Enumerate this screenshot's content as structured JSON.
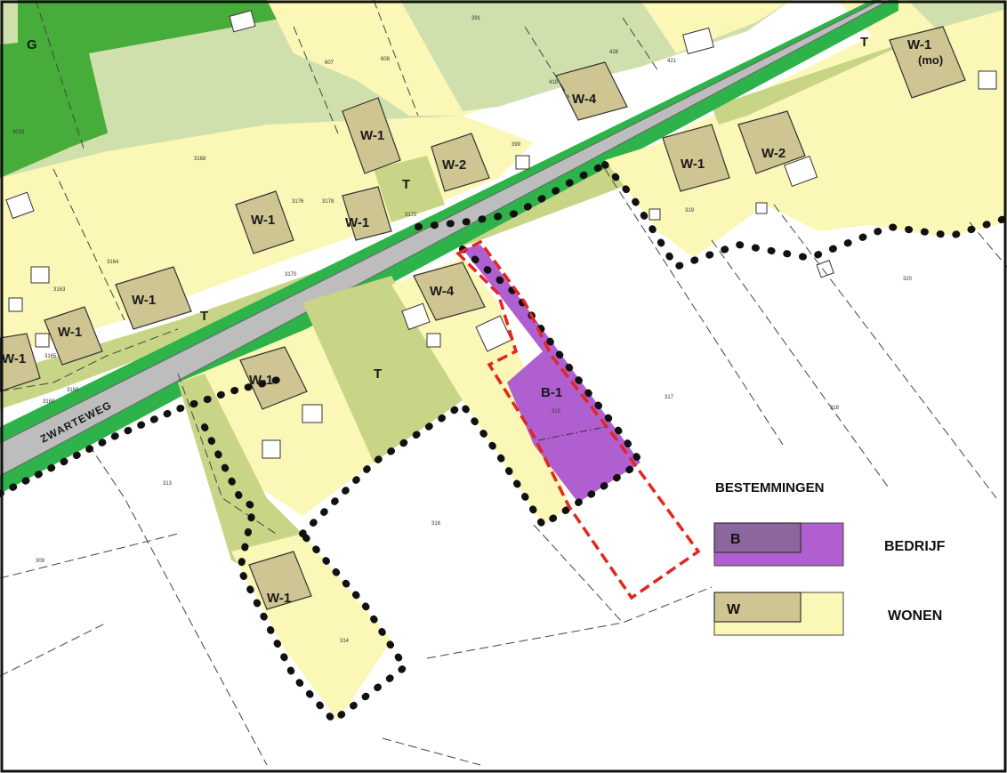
{
  "road": {
    "name": "ZWARTEWEG"
  },
  "labels": {
    "g": "G",
    "t_top": "T",
    "t_mid": "T",
    "t_left": "T",
    "t_south": "T",
    "w1_mo": "W-1",
    "mo": "(mo)",
    "w1_north_a": "W-1",
    "w1_north_b": "W-1",
    "w1_north_c": "W-1",
    "w1_left_a": "W-1",
    "w1_left_b": "W-1",
    "w1_left_c": "W-1",
    "w1_east": "W-1",
    "w1_south": "W-1",
    "w1_south2": "W-1",
    "w2_north": "W-2",
    "w2_east": "W-2",
    "w4_north": "W-4",
    "w4_south": "W-4",
    "b1": "B-1"
  },
  "numbers": {
    "n391": "391",
    "n607": "607",
    "n608": "608",
    "n3033": "3033",
    "n3168": "3168",
    "n3164": "3164",
    "n3163": "3163",
    "n3176": "3176",
    "n3178": "3178",
    "n3172": "3172",
    "n3170": "3170",
    "n421": "421",
    "n419": "419",
    "n428": "428",
    "n399": "399",
    "n317": "317",
    "n318": "318",
    "n313": "313",
    "n314": "314",
    "n316": "316",
    "n320": "320",
    "n309": "309",
    "n319": "319",
    "n315": "315",
    "n3160": "3160",
    "n3169": "3169",
    "n3165": "3165"
  },
  "legend": {
    "title": "BESTEMMINGEN",
    "items": [
      {
        "code": "B",
        "label": "BEDRIJF",
        "outer": "#b05fd0",
        "inner": "#8c679e"
      },
      {
        "code": "W",
        "label": "WONEN",
        "outer": "#fbf7b6",
        "inner": "#cfc592"
      }
    ]
  },
  "colors": {
    "road": "#bdbdbd",
    "verge": "#2eb24a",
    "green_dark": "#4cae3b",
    "green_light": "#cfe0ad",
    "tuin": "#c9d586",
    "wonen": "#fbf7b6",
    "wonen_building": "#cfc592",
    "bedrijf": "#b05fd0",
    "plan_boundary": "#e3261f"
  }
}
